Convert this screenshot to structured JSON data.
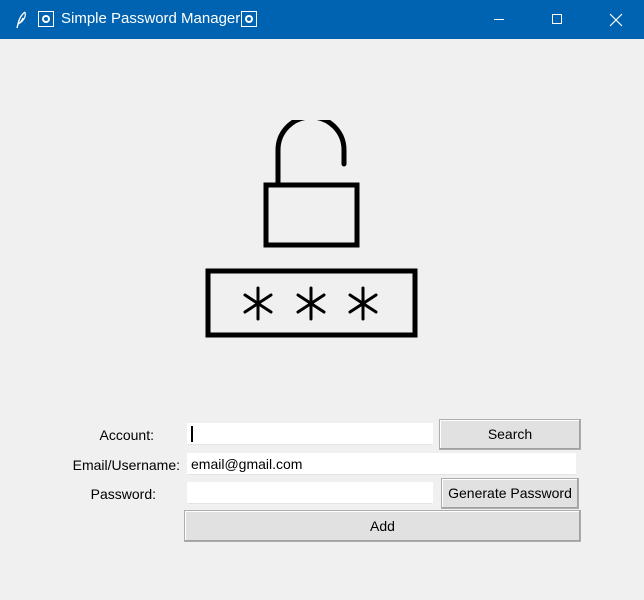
{
  "window": {
    "title": "Simple Password Manager",
    "titlebar_color": "#0063b1"
  },
  "logo": {
    "icon": "unlocked-padlock-with-password-icon",
    "mask_text": "***"
  },
  "form": {
    "account_label": "Account:",
    "account_value": "",
    "email_label": "Email/Username:",
    "email_value": "email@gmail.com",
    "password_label": "Password:",
    "password_value": "",
    "search_label": "Search",
    "generate_label": "Generate Password",
    "add_label": "Add"
  }
}
